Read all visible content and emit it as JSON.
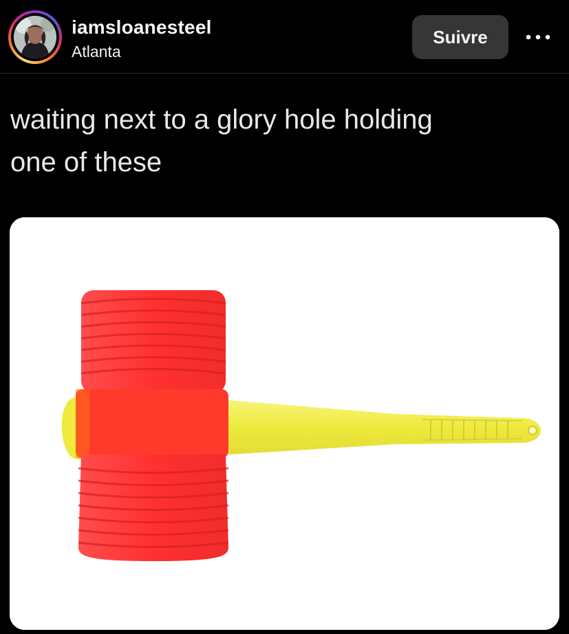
{
  "header": {
    "username": "iamsloanesteel",
    "location": "Atlanta",
    "follow_label": "Suivre",
    "more_icon": "more-horizontal-icon",
    "avatar_ring_colors": [
      "#feda75",
      "#fa7e1e",
      "#d62976",
      "#962fbf",
      "#4f5bd5"
    ]
  },
  "post": {
    "text_line1": "waiting next to a glory hole holding",
    "text_line2": "one of these"
  },
  "media": {
    "subject": "toy-squeaky-hammer-image",
    "colors": {
      "head": "#ff3b3b",
      "handle": "#f2ee46",
      "background": "#ffffff"
    }
  },
  "theme": {
    "background": "#000000",
    "text": "#f5f5f5",
    "button_bg": "#363636"
  }
}
